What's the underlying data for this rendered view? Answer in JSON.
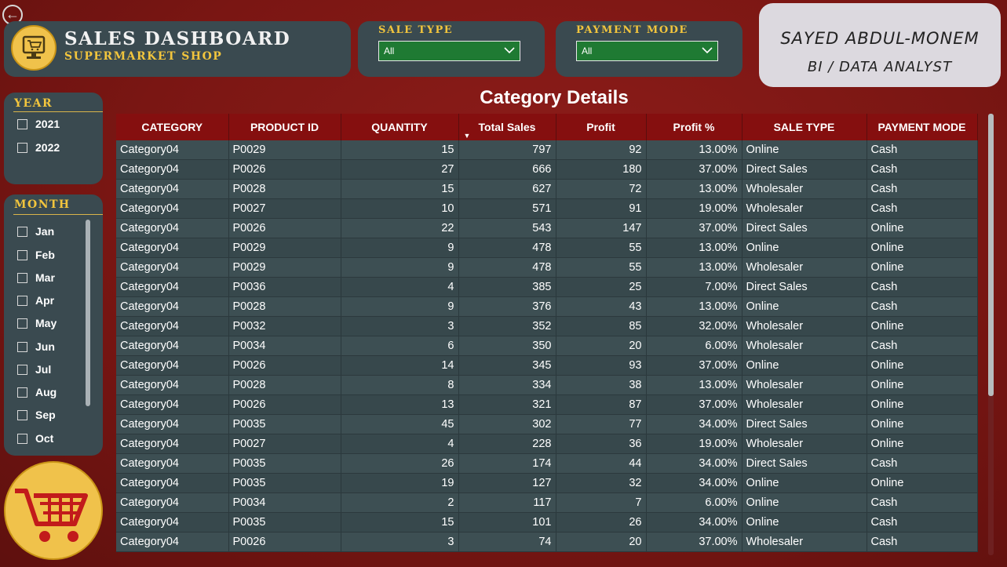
{
  "header": {
    "title": "SALES DASHBOARD",
    "subtitle": "SUPERMARKET SHOP"
  },
  "filters": {
    "sale_type": {
      "label": "SALE TYPE",
      "selected": "All"
    },
    "payment_mode": {
      "label": "PAYMENT MODE",
      "selected": "All"
    }
  },
  "author": {
    "name": "SAYED ABDUL-MONEM",
    "role": "BI / DATA ANALYST"
  },
  "year_slicer": {
    "label": "YEAR",
    "items": [
      {
        "label": "2021",
        "checked": false
      },
      {
        "label": "2022",
        "checked": false
      }
    ]
  },
  "month_slicer": {
    "label": "MONTH",
    "items": [
      {
        "label": "Jan"
      },
      {
        "label": "Feb"
      },
      {
        "label": "Mar"
      },
      {
        "label": "Apr"
      },
      {
        "label": "May"
      },
      {
        "label": "Jun"
      },
      {
        "label": "Jul"
      },
      {
        "label": "Aug"
      },
      {
        "label": "Sep"
      },
      {
        "label": "Oct"
      }
    ]
  },
  "table": {
    "title": "Category Details",
    "sorted_by": "Total Sales",
    "columns": [
      "CATEGORY",
      "PRODUCT ID",
      "QUANTITY",
      "Total Sales",
      "Profit",
      "Profit %",
      "SALE TYPE",
      "PAYMENT MODE"
    ],
    "rows": [
      [
        "Category04",
        "P0029",
        "15",
        "797",
        "92",
        "13.00%",
        "Online",
        "Cash"
      ],
      [
        "Category04",
        "P0026",
        "27",
        "666",
        "180",
        "37.00%",
        "Direct Sales",
        "Cash"
      ],
      [
        "Category04",
        "P0028",
        "15",
        "627",
        "72",
        "13.00%",
        "Wholesaler",
        "Cash"
      ],
      [
        "Category04",
        "P0027",
        "10",
        "571",
        "91",
        "19.00%",
        "Wholesaler",
        "Cash"
      ],
      [
        "Category04",
        "P0026",
        "22",
        "543",
        "147",
        "37.00%",
        "Direct Sales",
        "Online"
      ],
      [
        "Category04",
        "P0029",
        "9",
        "478",
        "55",
        "13.00%",
        "Online",
        "Online"
      ],
      [
        "Category04",
        "P0029",
        "9",
        "478",
        "55",
        "13.00%",
        "Wholesaler",
        "Online"
      ],
      [
        "Category04",
        "P0036",
        "4",
        "385",
        "25",
        "7.00%",
        "Direct Sales",
        "Cash"
      ],
      [
        "Category04",
        "P0028",
        "9",
        "376",
        "43",
        "13.00%",
        "Online",
        "Cash"
      ],
      [
        "Category04",
        "P0032",
        "3",
        "352",
        "85",
        "32.00%",
        "Wholesaler",
        "Online"
      ],
      [
        "Category04",
        "P0034",
        "6",
        "350",
        "20",
        "6.00%",
        "Wholesaler",
        "Cash"
      ],
      [
        "Category04",
        "P0026",
        "14",
        "345",
        "93",
        "37.00%",
        "Online",
        "Online"
      ],
      [
        "Category04",
        "P0028",
        "8",
        "334",
        "38",
        "13.00%",
        "Wholesaler",
        "Online"
      ],
      [
        "Category04",
        "P0026",
        "13",
        "321",
        "87",
        "37.00%",
        "Wholesaler",
        "Online"
      ],
      [
        "Category04",
        "P0035",
        "45",
        "302",
        "77",
        "34.00%",
        "Direct Sales",
        "Online"
      ],
      [
        "Category04",
        "P0027",
        "4",
        "228",
        "36",
        "19.00%",
        "Wholesaler",
        "Online"
      ],
      [
        "Category04",
        "P0035",
        "26",
        "174",
        "44",
        "34.00%",
        "Direct Sales",
        "Cash"
      ],
      [
        "Category04",
        "P0035",
        "19",
        "127",
        "32",
        "34.00%",
        "Online",
        "Online"
      ],
      [
        "Category04",
        "P0034",
        "2",
        "117",
        "7",
        "6.00%",
        "Online",
        "Cash"
      ],
      [
        "Category04",
        "P0035",
        "15",
        "101",
        "26",
        "34.00%",
        "Online",
        "Cash"
      ],
      [
        "Category04",
        "P0026",
        "3",
        "74",
        "20",
        "37.00%",
        "Wholesaler",
        "Cash"
      ]
    ]
  },
  "icons": {
    "back": "back-arrow-icon",
    "logo": "monitor-cart-icon",
    "dropdown": "chevron-down-icon",
    "badge": "shopping-cart-icon"
  },
  "colors": {
    "background": "#7a1613",
    "panel": "#3a4a50",
    "accent_gold": "#f2c53d",
    "table_header": "#850f0f",
    "dropdown_green": "#1f7a33"
  }
}
